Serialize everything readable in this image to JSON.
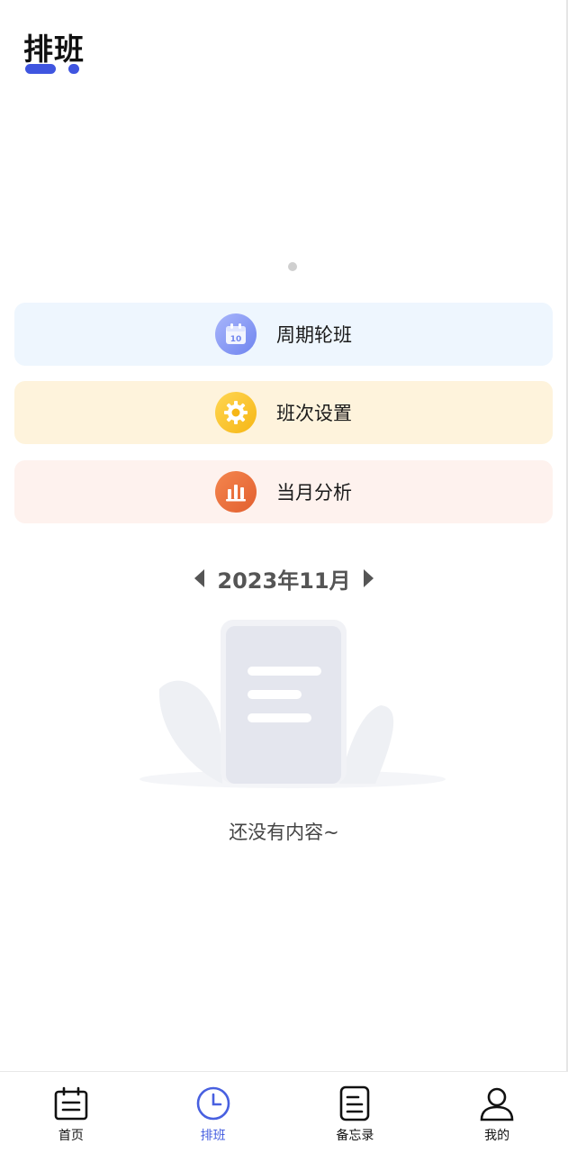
{
  "header": {
    "title": "排班"
  },
  "menu": {
    "items": [
      {
        "label": "周期轮班",
        "icon": "calendar-icon",
        "icon_text": "10"
      },
      {
        "label": "班次设置",
        "icon": "gear-icon"
      },
      {
        "label": "当月分析",
        "icon": "bar-chart-icon"
      }
    ]
  },
  "month_nav": {
    "label": "2023年11月"
  },
  "empty": {
    "text": "还没有内容~"
  },
  "tabbar": {
    "tabs": [
      {
        "label": "首页",
        "icon": "calendar-home-icon"
      },
      {
        "label": "排班",
        "icon": "clock-icon",
        "active": true
      },
      {
        "label": "备忘录",
        "icon": "memo-icon"
      },
      {
        "label": "我的",
        "icon": "person-icon"
      }
    ]
  },
  "colors": {
    "accent": "#3f55e0",
    "active_tab": "#4860e0",
    "card_blue": "#eef6fe",
    "card_yellow": "#fef3dc",
    "card_red": "#fef2ee"
  }
}
